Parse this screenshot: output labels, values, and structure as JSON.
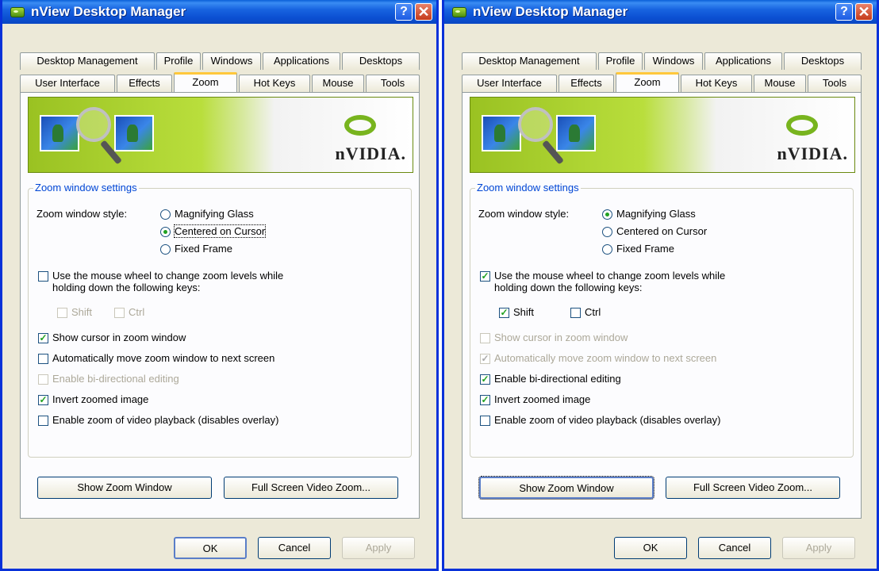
{
  "left": {
    "title": "nView Desktop Manager",
    "tabs_top": [
      "Desktop Management",
      "Profile",
      "Windows",
      "Applications",
      "Desktops"
    ],
    "tabs_bottom": [
      "User Interface",
      "Effects",
      "Zoom",
      "Hot Keys",
      "Mouse",
      "Tools"
    ],
    "banner_brand": "nVIDIA.",
    "group_title": "Zoom window settings",
    "style_label": "Zoom window style:",
    "radios": [
      "Magnifying Glass",
      "Centered on Cursor",
      "Fixed Frame"
    ],
    "selected_radio": "Centered on Cursor",
    "wheel_line1": "Use the mouse wheel to change zoom levels while",
    "wheel_line2": "holding down the following keys:",
    "shift": "Shift",
    "ctrl": "Ctrl",
    "show_cursor": "Show cursor in zoom window",
    "auto_move": "Automatically move zoom window to next screen",
    "bidir": "Enable bi-directional editing",
    "invert": "Invert zoomed image",
    "video": "Enable zoom of video playback (disables overlay)",
    "show_zoom_btn": "Show Zoom Window",
    "full_screen_btn": "Full Screen Video Zoom...",
    "ok": "OK",
    "cancel": "Cancel",
    "apply": "Apply"
  },
  "right": {
    "title": "nView Desktop Manager",
    "tabs_top": [
      "Desktop Management",
      "Profile",
      "Windows",
      "Applications",
      "Desktops"
    ],
    "tabs_bottom": [
      "User Interface",
      "Effects",
      "Zoom",
      "Hot Keys",
      "Mouse",
      "Tools"
    ],
    "banner_brand": "nVIDIA.",
    "group_title": "Zoom window settings",
    "style_label": "Zoom window style:",
    "radios": [
      "Magnifying Glass",
      "Centered on Cursor",
      "Fixed Frame"
    ],
    "selected_radio": "Magnifying Glass",
    "wheel_line1": "Use the mouse wheel to change zoom levels while",
    "wheel_line2": "holding down the following keys:",
    "shift": "Shift",
    "ctrl": "Ctrl",
    "show_cursor": "Show cursor in zoom window",
    "auto_move": "Automatically move zoom window to next screen",
    "bidir": "Enable bi-directional editing",
    "invert": "Invert zoomed image",
    "video": "Enable zoom of video playback (disables overlay)",
    "show_zoom_btn": "Show Zoom Window",
    "full_screen_btn": "Full Screen Video Zoom...",
    "ok": "OK",
    "cancel": "Cancel",
    "apply": "Apply"
  },
  "icons": {
    "help": "help-icon",
    "close": "close-icon",
    "app": "nvidia-app-icon"
  },
  "colors": {
    "titlebar": "#0a5fd8",
    "group_title": "#0046d5",
    "check": "#21a121",
    "active_tab": "#ffc83c"
  }
}
